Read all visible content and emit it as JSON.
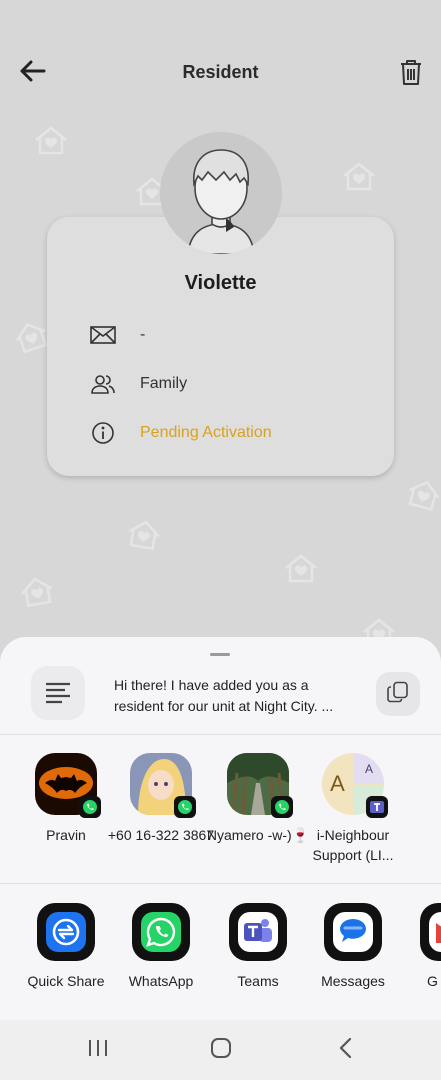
{
  "header": {
    "title": "Resident",
    "back_icon": "arrow-left-icon",
    "delete_icon": "trash-icon"
  },
  "profile": {
    "name": "Violette",
    "email": "-",
    "relation": "Family",
    "status": "Pending Activation",
    "status_color": "#d9a21c"
  },
  "share_sheet": {
    "preview_text": "Hi there! I have added you as a resident for our unit at Night City. ...",
    "preview_icon": "text-lines-icon",
    "copy_icon": "copy-icon",
    "contacts": [
      {
        "name": "Pravin",
        "badge": "whatsapp-icon"
      },
      {
        "name": "+60 16-322 3867",
        "badge": "whatsapp-icon"
      },
      {
        "name": "Nyamero -w-)🍷",
        "badge": "whatsapp-icon"
      },
      {
        "name": "i-Neighbour Support (LI...",
        "badge": "teams-icon",
        "avatar_letters": [
          "A",
          "A"
        ]
      }
    ],
    "apps": [
      {
        "label": "Quick Share",
        "icon": "quick-share-icon"
      },
      {
        "label": "WhatsApp",
        "icon": "whatsapp-icon"
      },
      {
        "label": "Teams",
        "icon": "teams-icon"
      },
      {
        "label": "Messages",
        "icon": "messages-icon"
      },
      {
        "label": "G",
        "icon": "gmail-icon"
      }
    ]
  },
  "navbar": {
    "recents_icon": "recents-icon",
    "home_icon": "home-icon",
    "back_icon": "back-chevron-icon"
  }
}
